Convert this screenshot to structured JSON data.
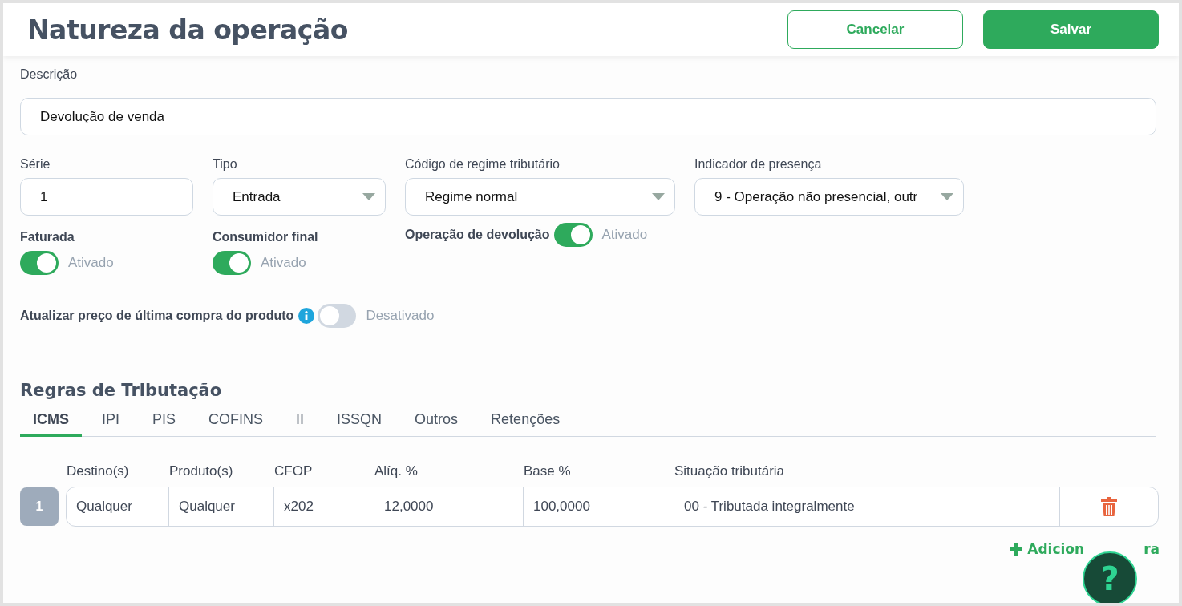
{
  "header": {
    "title": "Natureza da operação",
    "buttons": [
      {
        "label": "Cancelar",
        "kind": "secondary"
      },
      {
        "label": "Salvar",
        "kind": "primary"
      }
    ]
  },
  "description": {
    "label": "Descrição",
    "value": "Devolução de venda"
  },
  "fields": [
    {
      "label": "Série",
      "value": "1",
      "kind": "input"
    },
    {
      "label": "Tipo",
      "value": "Entrada",
      "kind": "select"
    },
    {
      "label": "Código de regime tributário",
      "value": "Regime normal",
      "kind": "select"
    },
    {
      "label": "Indicador de presença",
      "value": "9 - Operação não presencial, outr",
      "kind": "select"
    }
  ],
  "toggles": [
    {
      "label": "Faturada",
      "on": true,
      "status": "Ativado",
      "kind": "stacked"
    },
    {
      "label": "Consumidor final",
      "on": true,
      "status": "Ativado",
      "kind": "stacked"
    },
    {
      "label": "Operação de devolução",
      "on": true,
      "status": "Ativado",
      "kind": "inline"
    }
  ],
  "price_toggle": {
    "label": "Atualizar preço de última compra do produto",
    "on": false,
    "status": "Desativado"
  },
  "section_title": "Regras de Tributação",
  "tabs": [
    {
      "label": "ICMS",
      "selected": true
    },
    {
      "label": "IPI",
      "selected": false
    },
    {
      "label": "PIS",
      "selected": false
    },
    {
      "label": "COFINS",
      "selected": false
    },
    {
      "label": "II",
      "selected": false
    },
    {
      "label": "ISSQN",
      "selected": false
    },
    {
      "label": "Outros",
      "selected": false
    },
    {
      "label": "Retenções",
      "selected": false
    }
  ],
  "table": {
    "columns": [
      "Destino(s)",
      "Produto(s)",
      "CFOP",
      "Alíq. %",
      "Base %",
      "Situação tributária"
    ],
    "rows": [
      {
        "index": "1",
        "cells": [
          "Qualquer",
          "Qualquer",
          "x202",
          "12,0000",
          "100,0000",
          "00 - Tributada integralmente"
        ]
      }
    ]
  },
  "add_link": [
    "Adicion",
    "ra"
  ],
  "help": "?"
}
